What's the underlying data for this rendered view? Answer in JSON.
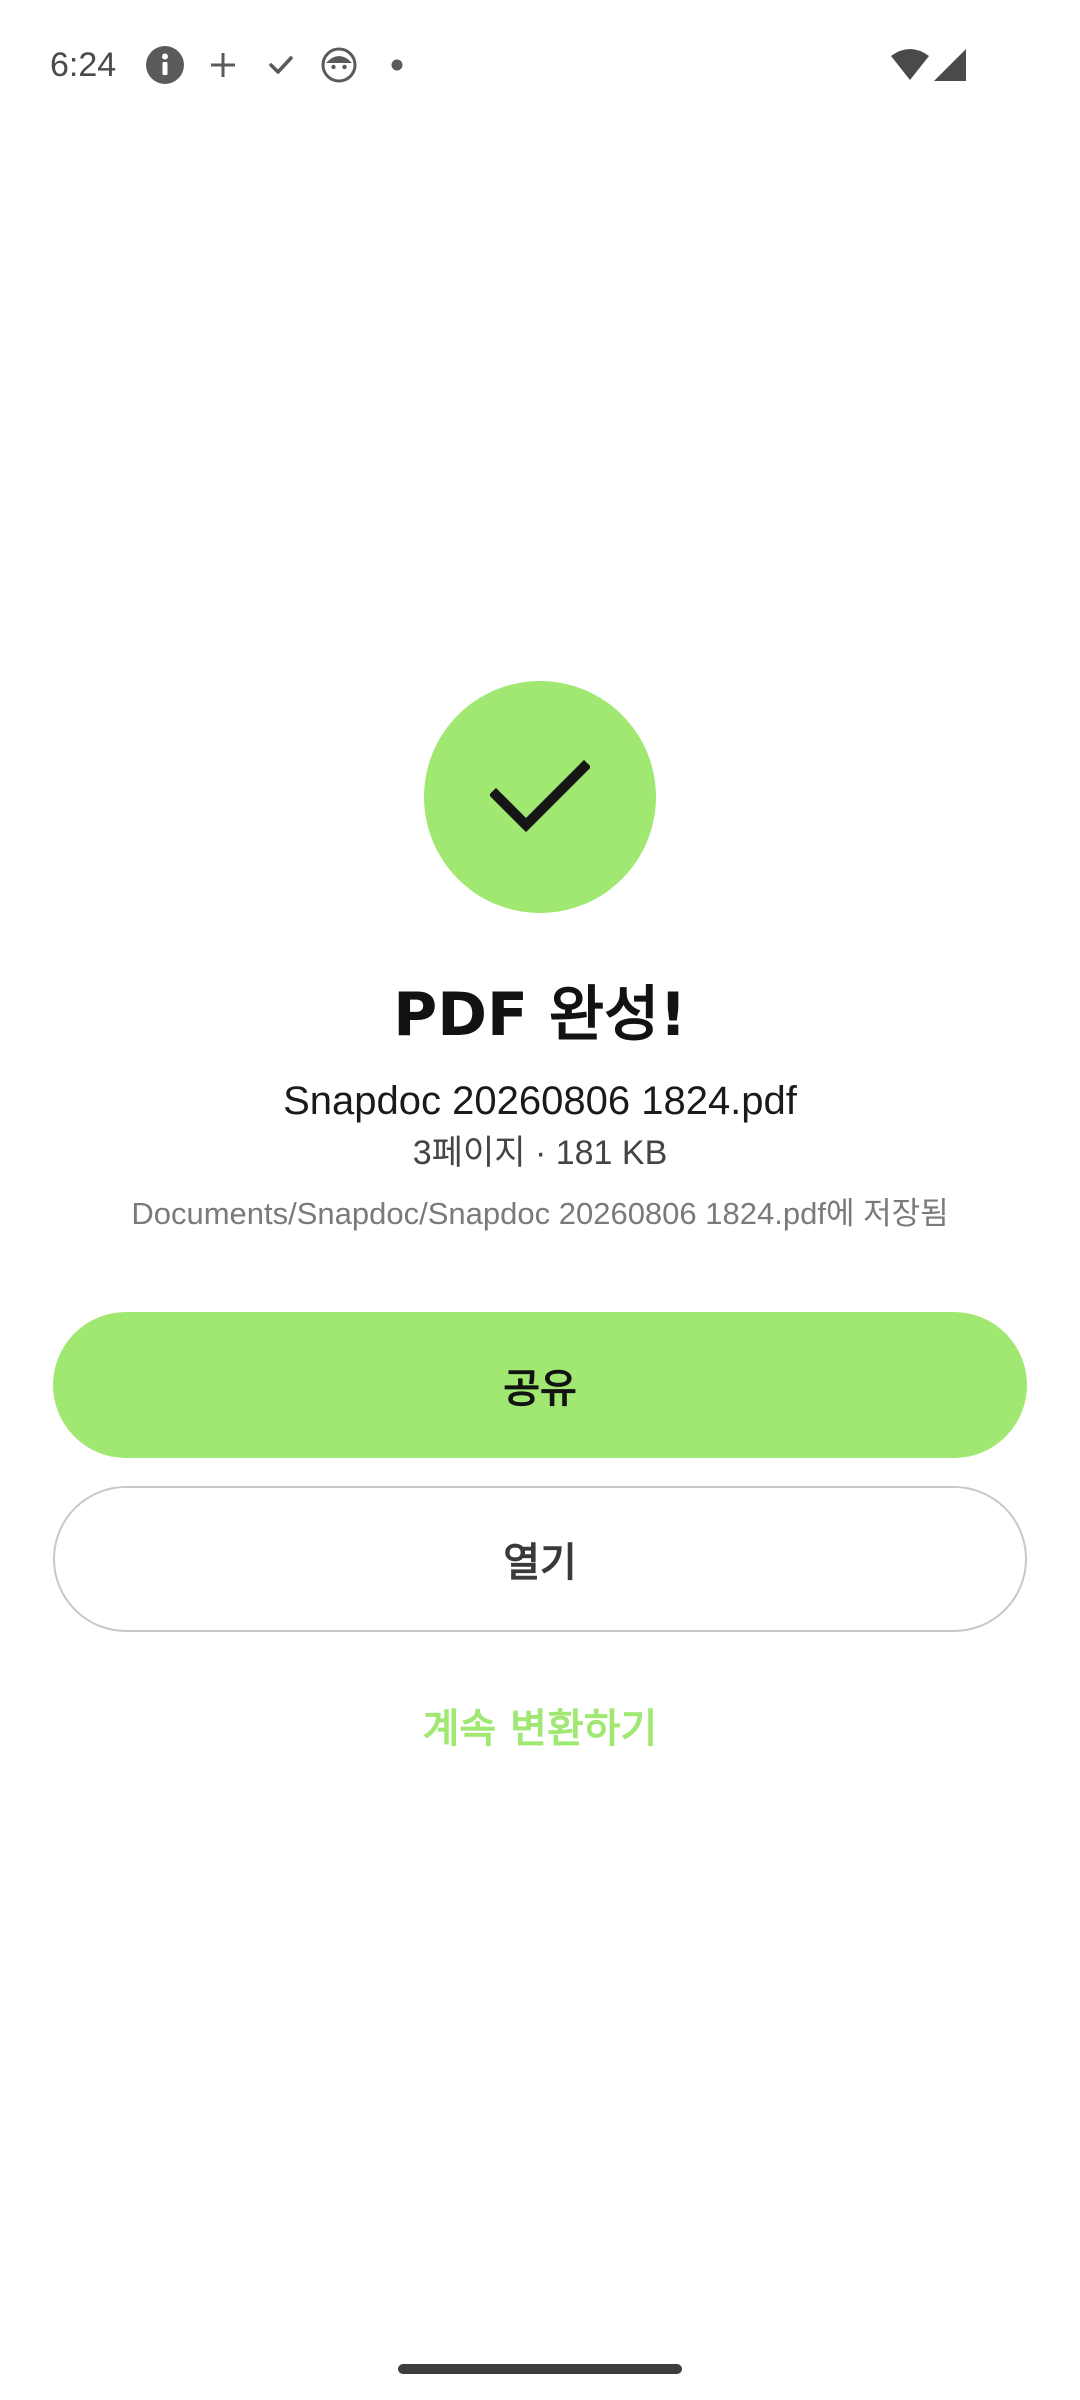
{
  "status_bar": {
    "time": "6:24",
    "left_icons": [
      "info-icon",
      "plus-icon",
      "check-icon",
      "android-face-icon",
      "dot-icon"
    ],
    "right_icons": [
      "wifi-icon",
      "cellular-signal-icon"
    ]
  },
  "success": {
    "icon": "checkmark-icon",
    "accent_color": "#a0e872"
  },
  "result": {
    "title": "PDF 완성!",
    "file_name": "Snapdoc 20260806 1824.pdf",
    "meta": "3페이지 · 181 KB",
    "saved_path": "Documents/Snapdoc/Snapdoc 20260806 1824.pdf에 저장됨"
  },
  "actions": {
    "share_label": "공유",
    "open_label": "열기",
    "continue_label": "계속 변환하기"
  }
}
